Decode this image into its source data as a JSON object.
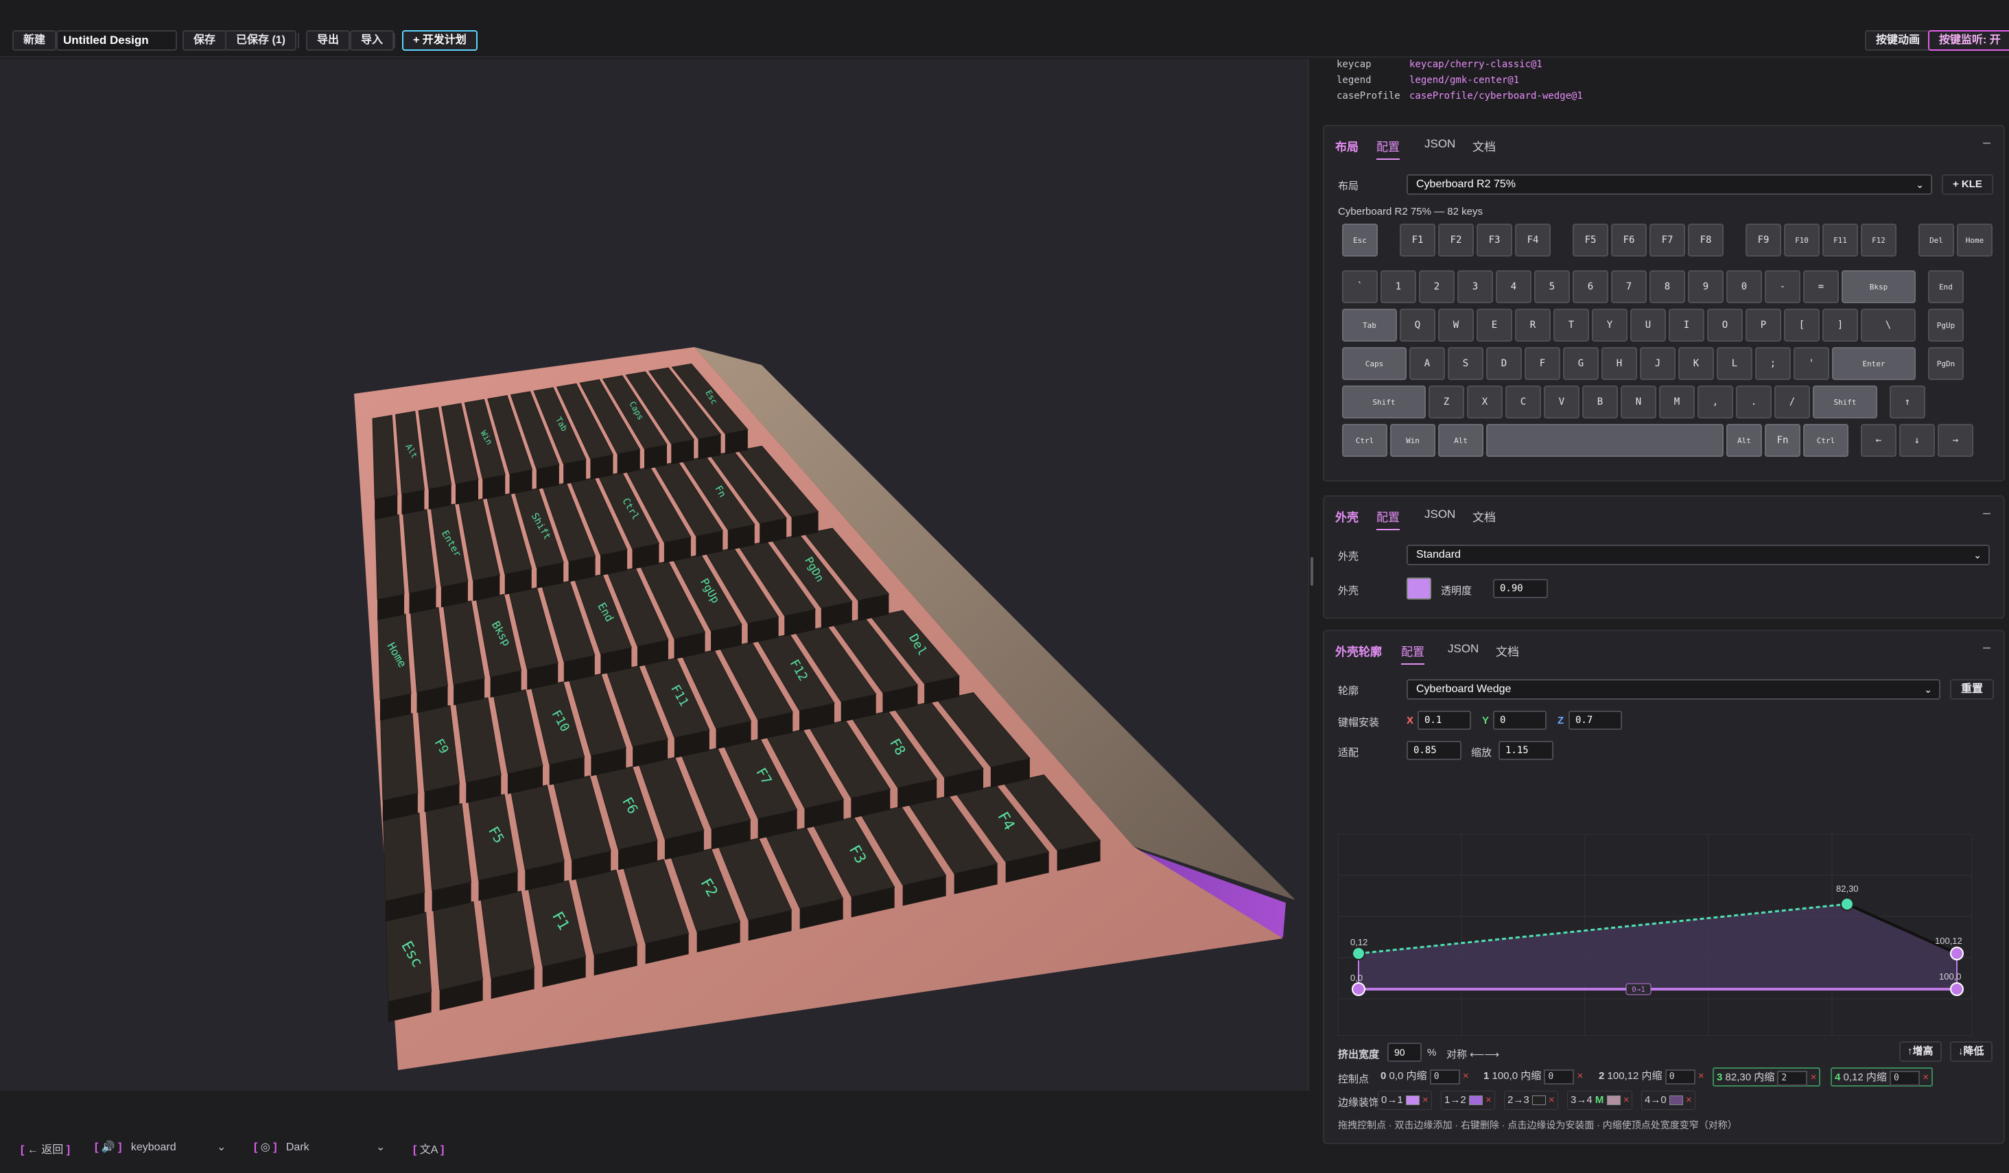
{
  "toolbar": {
    "new_label": "新建",
    "design_name": "Untitled Design",
    "save_label": "保存",
    "saved_label": "已保存 (1)",
    "export_label": "导出",
    "import_label": "导入",
    "plan_label": "+ 开发计划",
    "key_anim_label": "按键动画",
    "key_monitor_label": "按键监听: 开"
  },
  "profile_info": [
    {
      "key": "keycap",
      "value": "keycap/cherry-classic@1"
    },
    {
      "key": "legend",
      "value": "legend/gmk-center@1"
    },
    {
      "key": "caseProfile",
      "value": "caseProfile/cyberboard-wedge@1"
    }
  ],
  "layout_card": {
    "title": "布局",
    "tabs": [
      "配置",
      "JSON",
      "文档"
    ],
    "field_label": "布局",
    "layout_value": "Cyberboard R2 75%",
    "kle_label": "+ KLE",
    "summary": "Cyberboard R2 75% — 82 keys",
    "keys": [
      [
        "Esc",
        "F1",
        "F2",
        "F3",
        "F4",
        "F5",
        "F6",
        "F7",
        "F8",
        "F9",
        "F10",
        "F11",
        "F12",
        "Del",
        "Home"
      ],
      [
        "`",
        "1",
        "2",
        "3",
        "4",
        "5",
        "6",
        "7",
        "8",
        "9",
        "0",
        "-",
        "=",
        "Bksp",
        "End"
      ],
      [
        "Tab",
        "Q",
        "W",
        "E",
        "R",
        "T",
        "Y",
        "U",
        "I",
        "O",
        "P",
        "[",
        "]",
        "\\",
        "PgUp"
      ],
      [
        "Caps",
        "A",
        "S",
        "D",
        "F",
        "G",
        "H",
        "J",
        "K",
        "L",
        ";",
        "'",
        "Enter",
        "PgDn"
      ],
      [
        "Shift",
        "Z",
        "X",
        "C",
        "V",
        "B",
        "N",
        "M",
        ",",
        ".",
        "/",
        "Shift",
        "↑"
      ],
      [
        "Ctrl",
        "Win",
        "Alt",
        "",
        "Alt",
        "Fn",
        "Ctrl",
        "←",
        "↓",
        "→"
      ]
    ]
  },
  "case_card": {
    "title": "外壳",
    "tabs": [
      "配置",
      "JSON",
      "文档"
    ],
    "field_label": "外壳",
    "case_value": "Standard",
    "color_label": "外壳",
    "color": "#c58af0",
    "opacity_label": "透明度",
    "opacity_value": "0.90"
  },
  "outline_card": {
    "title": "外壳轮廓",
    "tabs": [
      "配置",
      "JSON",
      "文档"
    ],
    "profile_label": "轮廓",
    "profile_value": "Cyberboard Wedge",
    "reset_label": "重置",
    "mount_label": "键帽安装",
    "x_label": "X",
    "x_value": "0.1",
    "y_label": "Y",
    "y_value": "0",
    "z_label": "Z",
    "z_value": "0.7",
    "fit_label": "适配",
    "fit_value": "0.85",
    "scale_label": "缩放",
    "scale_value": "1.15",
    "graph": {
      "points": [
        {
          "label": "0,12"
        },
        {
          "label": "0,0"
        },
        {
          "label": "82,30"
        },
        {
          "label": "100,12"
        },
        {
          "label": "100,0"
        }
      ],
      "edge_labels": [
        "0→1"
      ]
    },
    "extrude_label": "挤出宽度",
    "extrude_value": "90",
    "extrude_unit": "%",
    "symmetry_label": "对称 ⟵⟶",
    "raise_label": "↑增高",
    "lower_label": "↓降低",
    "ctrl_label": "控制点",
    "ctrl_points": [
      {
        "idx": "0",
        "coord": "0,0",
        "inset_label": "内缩",
        "inset": "0"
      },
      {
        "idx": "1",
        "coord": "100,0",
        "inset_label": "内缩",
        "inset": "0"
      },
      {
        "idx": "2",
        "coord": "100,12",
        "inset_label": "内缩",
        "inset": "0"
      },
      {
        "idx": "3",
        "coord": "82,30",
        "inset_label": "内缩",
        "inset": "2"
      },
      {
        "idx": "4",
        "coord": "0,12",
        "inset_label": "内缩",
        "inset": "0"
      }
    ],
    "edge_label": "边缘装饰",
    "edges": [
      "0→1",
      "1→2",
      "2→3",
      "3→4",
      "4→0"
    ],
    "edge_m": "M",
    "hint": "拖拽控制点 · 双击边缘添加 · 右键删除 · 点击边缘设为安装面 · 内缩使顶点处宽度变窄（对称）"
  },
  "bottom": {
    "back_label": "← 返回",
    "sound_icon": "speaker-icon",
    "sound_value": "keyboard",
    "theme_icon": "palette-icon",
    "theme_value": "Dark",
    "lang_icon": "translate-icon"
  },
  "keyboard_legends": [
    "Esc",
    "F1",
    "F2",
    "F3",
    "F4",
    "F5",
    "F6",
    "F7",
    "F8",
    "F9",
    "F10",
    "F11",
    "F12",
    "Del",
    "Home",
    "Bksp",
    "End",
    "PgUp",
    "PgDn",
    "Enter",
    "Shift",
    "Ctrl",
    "Fn",
    "Alt",
    "Win",
    "Tab",
    "Caps"
  ]
}
